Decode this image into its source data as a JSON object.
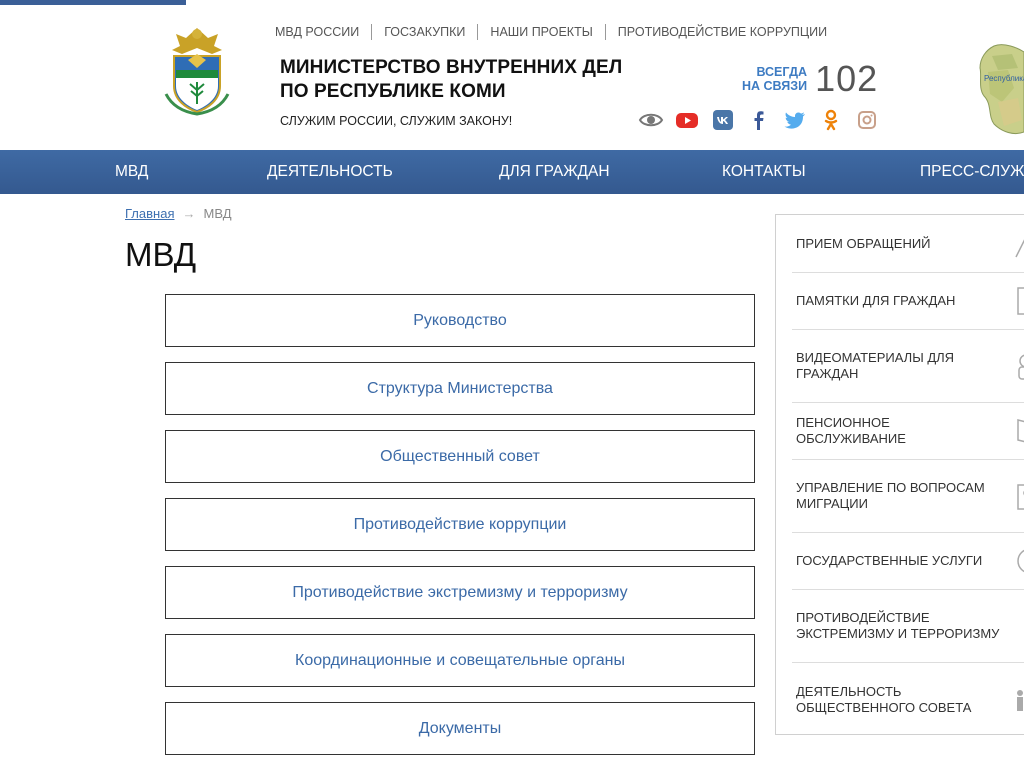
{
  "header": {
    "top_links": [
      "МВД России",
      "Госзакупки",
      "Наши проекты",
      "Противодействие коррупции"
    ],
    "title_line1": "Министерство внутренних дел",
    "title_line2": "по Республике Коми",
    "slogan": "Служим России, служим Закону!",
    "hotline_label_line1": "всегда",
    "hotline_label_line2": "на связи",
    "hotline_number": "102",
    "socials": [
      "eye-icon",
      "youtube-icon",
      "vk-icon",
      "facebook-icon",
      "twitter-icon",
      "odnoklassniki-icon",
      "instagram-icon"
    ],
    "map_label": "Республика"
  },
  "nav": {
    "items": [
      "МВД",
      "Деятельность",
      "Для граждан",
      "Контакты",
      "Пресс-служба"
    ]
  },
  "breadcrumb": {
    "home": "Главная",
    "arrow": "→",
    "current": "МВД"
  },
  "page_title": "МВД",
  "menu": {
    "items": [
      "Руководство",
      "Структура Министерства",
      "Общественный совет",
      "Противодействие коррупции",
      "Противодействие экстремизму и терроризму",
      "Координационные и совещательные органы",
      "Документы"
    ]
  },
  "sidebar": {
    "items": [
      {
        "label": "Прием обращений",
        "icon": "pen-icon"
      },
      {
        "label": "Памятки для граждан",
        "icon": "notebook-icon"
      },
      {
        "label": "Видеоматериалы для граждан",
        "icon": "camera-icon"
      },
      {
        "label": "Пенсионное обслуживание",
        "icon": "book-icon"
      },
      {
        "label": "Управление по вопросам миграции",
        "icon": "id-card-icon"
      },
      {
        "label": "Государственные услуги",
        "icon": "services-icon"
      },
      {
        "label": "Противодействие экстремизму и терроризму",
        "icon": ""
      },
      {
        "label": "Деятельность общественного совета",
        "icon": "people-icon"
      }
    ]
  },
  "colors": {
    "nav_bg": "#3a6299",
    "link": "#3b6aa7",
    "hotline_label": "#3d7bc2"
  }
}
